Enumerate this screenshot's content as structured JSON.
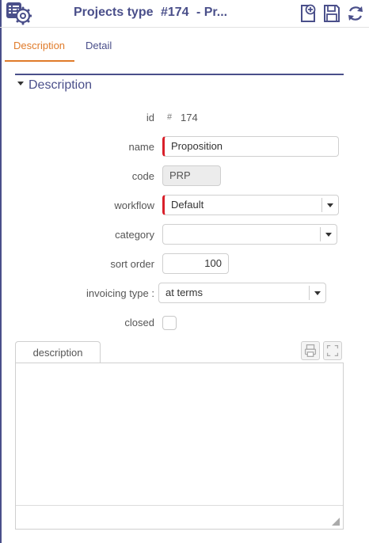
{
  "header": {
    "title": "Projects type",
    "id_text": "#174",
    "name_short": "- Pr..."
  },
  "tabs": [
    {
      "label": "Description",
      "active": true
    },
    {
      "label": "Detail",
      "active": false
    }
  ],
  "section": {
    "title": "Description"
  },
  "form": {
    "id_label": "id",
    "id_hash": "#",
    "id_value": "174",
    "name_label": "name",
    "name_value": "Proposition",
    "code_label": "code",
    "code_value": "PRP",
    "workflow_label": "workflow",
    "workflow_value": "Default",
    "category_label": "category",
    "category_value": "",
    "sort_order_label": "sort order",
    "sort_order_value": "100",
    "invoicing_label": "invoicing type :",
    "invoicing_value": "at terms",
    "closed_label": "closed",
    "closed_checked": false
  },
  "editor": {
    "tab_label": "description",
    "content": ""
  },
  "colors": {
    "accent": "#e07b2a",
    "primary": "#4a4f8a",
    "required": "#d9202a"
  },
  "icons": {
    "app": "projects-type-gear-icon",
    "new": "new-document-icon",
    "save": "save-icon",
    "refresh": "refresh-icon",
    "print": "print-icon",
    "fullscreen": "fullscreen-icon"
  }
}
